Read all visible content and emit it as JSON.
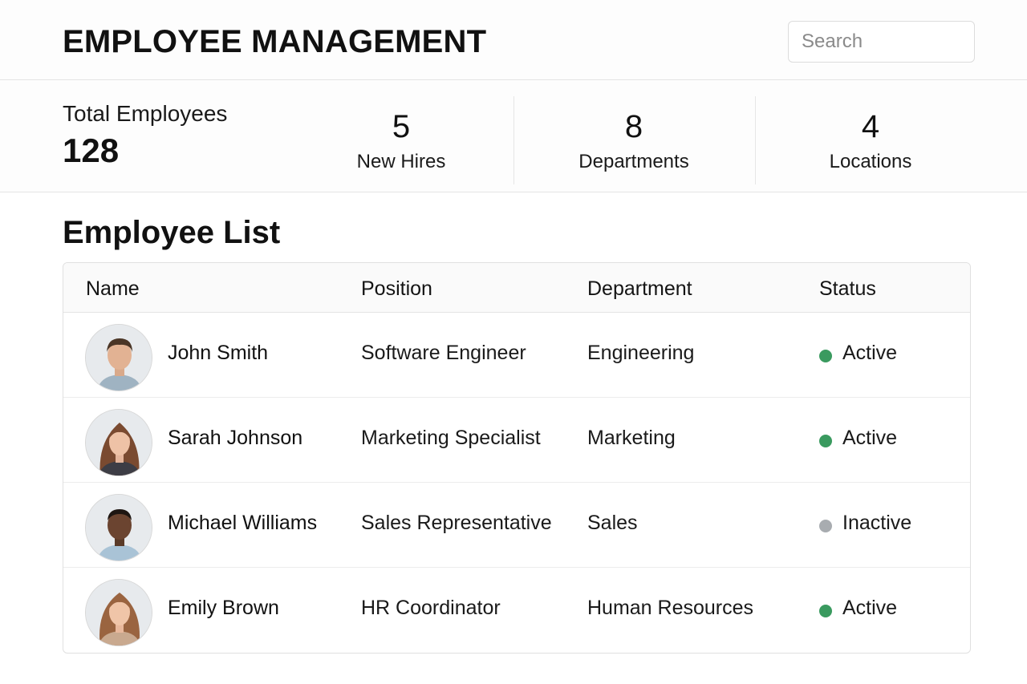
{
  "header": {
    "title": "EMPLOYEE MANAGEMENT",
    "search_placeholder": "Search"
  },
  "stats": {
    "total": {
      "label": "Total Employees",
      "value": "128"
    },
    "new_hires": {
      "label": "New Hires",
      "value": "5"
    },
    "departments": {
      "label": "Departments",
      "value": "8"
    },
    "locations": {
      "label": "Locations",
      "value": "4"
    }
  },
  "section": {
    "title": "Employee List"
  },
  "table": {
    "headers": {
      "name": "Name",
      "position": "Position",
      "department": "Department",
      "status": "Status"
    },
    "rows": [
      {
        "name": "John Smith",
        "position": "Software Engineer",
        "department": "Engineering",
        "status": "Active"
      },
      {
        "name": "Sarah Johnson",
        "position": "Marketing Specialist",
        "department": "Marketing",
        "status": "Active"
      },
      {
        "name": "Michael Williams",
        "position": "Sales Representative",
        "department": "Sales",
        "status": "Inactive"
      },
      {
        "name": "Emily Brown",
        "position": "HR Coordinator",
        "department": "Human Resources",
        "status": "Active"
      }
    ]
  },
  "colors": {
    "active": "#3a9a5f",
    "inactive": "#a8acb0"
  }
}
